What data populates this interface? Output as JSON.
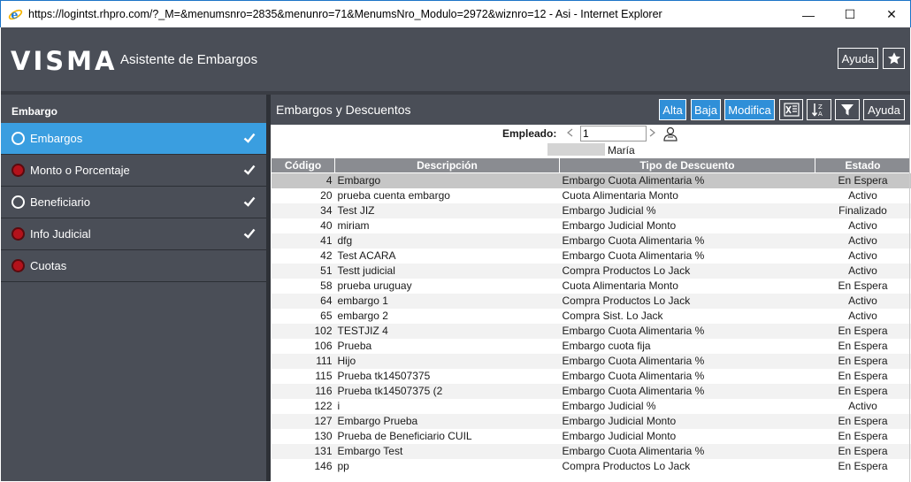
{
  "window": {
    "title": "https://logintst.rhpro.com/?_M=&menumsnro=2835&menunro=71&MenumsNro_Modulo=2972&wiznro=12 - Asi - Internet Explorer",
    "minimize": "—",
    "maximize": "☐",
    "close": "✕"
  },
  "header": {
    "logo": "VISMA",
    "title": "Asistente de Embargos",
    "help_label": "Ayuda"
  },
  "sidebar": {
    "heading": "Embargo",
    "items": [
      {
        "label": "Embargos",
        "state": "active",
        "checked": true
      },
      {
        "label": "Monto o Porcentaje",
        "state": "error",
        "checked": true
      },
      {
        "label": "Beneficiario",
        "state": "empty",
        "checked": true
      },
      {
        "label": "Info Judicial",
        "state": "error",
        "checked": true
      },
      {
        "label": "Cuotas",
        "state": "error",
        "checked": false
      }
    ]
  },
  "panel": {
    "title": "Embargos y Descuentos",
    "buttons": {
      "alta": "Alta",
      "baja": "Baja",
      "modifica": "Modifica",
      "ayuda": "Ayuda"
    },
    "employee": {
      "label": "Empleado:",
      "value": "1",
      "name": "María"
    }
  },
  "table": {
    "columns": [
      "Código",
      "Descripción",
      "Tipo de Descuento",
      "Estado"
    ],
    "rows": [
      [
        "4",
        "Embargo",
        "Embargo Cuota Alimentaria %",
        "En Espera"
      ],
      [
        "20",
        "prueba cuenta embargo",
        "Cuota Alimentaria Monto",
        "Activo"
      ],
      [
        "34",
        "Test JIZ",
        "Embargo Judicial %",
        "Finalizado"
      ],
      [
        "40",
        "miriam",
        "Embargo Judicial Monto",
        "Activo"
      ],
      [
        "41",
        "dfg",
        "Embargo Cuota Alimentaria %",
        "Activo"
      ],
      [
        "42",
        "Test ACARA",
        "Embargo Cuota Alimentaria %",
        "Activo"
      ],
      [
        "51",
        "Testt judicial",
        "Compra Productos Lo Jack",
        "Activo"
      ],
      [
        "58",
        "prueba uruguay",
        "Cuota Alimentaria Monto",
        "En Espera"
      ],
      [
        "64",
        "embargo 1",
        "Compra Productos Lo Jack",
        "Activo"
      ],
      [
        "65",
        "embargo 2",
        "Compra Sist. Lo Jack",
        "Activo"
      ],
      [
        "102",
        "TESTJIZ 4",
        "Embargo Cuota Alimentaria %",
        "En Espera"
      ],
      [
        "106",
        "Prueba",
        "Embargo cuota fija",
        "En Espera"
      ],
      [
        "111",
        "Hijo",
        "Embargo Cuota Alimentaria %",
        "En Espera"
      ],
      [
        "115",
        "Prueba tk14507375",
        "Embargo Cuota Alimentaria %",
        "En Espera"
      ],
      [
        "116",
        "Prueba tk14507375 (2",
        "Embargo Cuota Alimentaria %",
        "En Espera"
      ],
      [
        "122",
        "i",
        "Embargo Judicial %",
        "Activo"
      ],
      [
        "127",
        "Embargo Prueba",
        "Embargo Judicial Monto",
        "En Espera"
      ],
      [
        "130",
        "Prueba de Beneficiario CUIL",
        "Embargo Judicial Monto",
        "En Espera"
      ],
      [
        "131",
        "Embargo Test",
        "Embargo Cuota Alimentaria %",
        "En Espera"
      ],
      [
        "146",
        "pp",
        "Compra Productos Lo Jack",
        "En Espera"
      ]
    ]
  },
  "colors": {
    "header_bg": "#4a4e57",
    "active_step": "#3a9ee0",
    "error_dot": "#b3121b",
    "button_blue": "#2f8fd8",
    "table_header": "#8a8c91"
  }
}
